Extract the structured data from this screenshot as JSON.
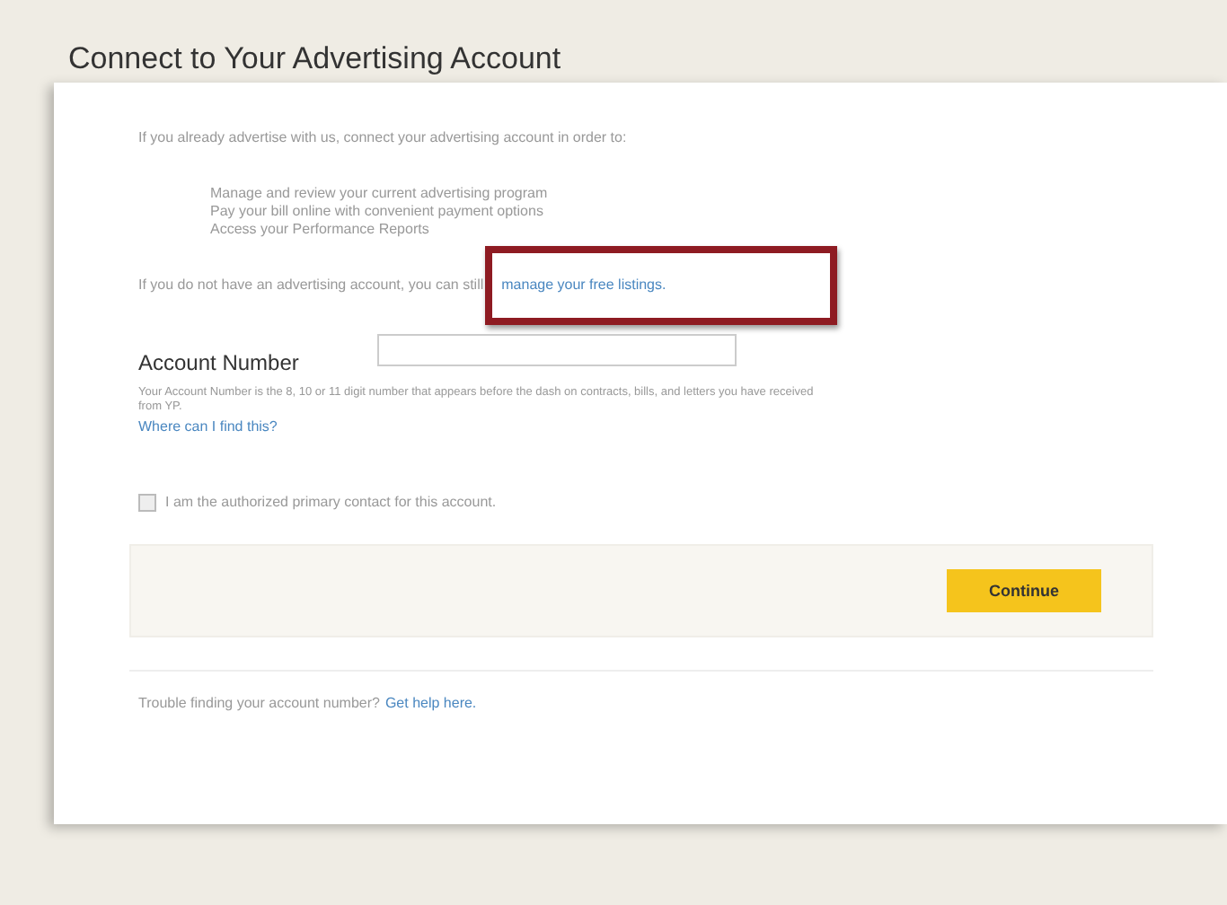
{
  "page": {
    "title": "Connect to Your Advertising Account"
  },
  "intro": "If you already advertise with us, connect your advertising account in order to:",
  "benefits": [
    "Manage and review your current advertising program",
    "Pay your bill online with convenient payment options",
    "Access your Performance Reports"
  ],
  "no_account": {
    "text": "If you do not have an advertising account, you can still",
    "link": "manage your free listings.",
    "highlighted": true
  },
  "account_number": {
    "label": "Account Number",
    "help": "Your Account Number is the 8, 10 or 11 digit number that appears before the dash on contracts, bills, and letters you have received from YP.",
    "help_link": "Where can I find this?"
  },
  "authorized_contact": {
    "label": "I am the authorized primary contact for this account.",
    "checked": false
  },
  "continue_button": "Continue",
  "trouble": {
    "text": "Trouble finding your account number?",
    "link": "Get help here."
  }
}
